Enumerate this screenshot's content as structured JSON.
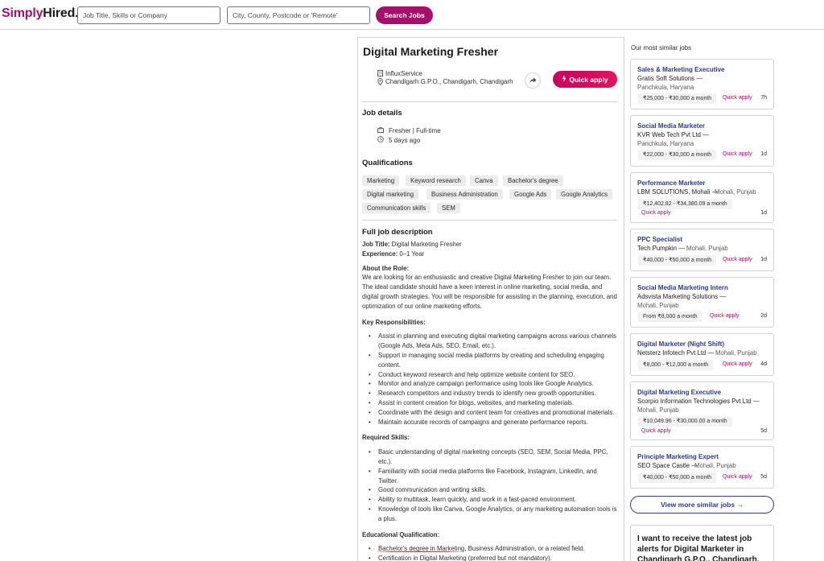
{
  "header": {
    "logo_simply": "Simply",
    "logo_hired": "Hired.",
    "what_placeholder": "Job Title, Skills or Company",
    "where_placeholder": "City, County, Postcode or 'Remote'",
    "search_label": "Search Jobs",
    "brand_color": "#a80f6b"
  },
  "job": {
    "title": "Digital Marketing Fresher",
    "company": "InfluxService",
    "location": "Chandigarh G.P.O., Chandigarh, Chandigarh",
    "quick_apply": "Quick apply",
    "details_heading": "Job details",
    "job_type": "Fresher | Full-time",
    "posted": "5 days ago",
    "qualifications_heading": "Qualifications",
    "qualifications": [
      "Marketing",
      "Keyword research",
      "Canva",
      "Bachelor's degree",
      "Digital marketing",
      "Business Administration",
      "Google Ads",
      "Google Analytics",
      "Communication skills",
      "SEM"
    ],
    "full_desc_heading": "Full job description",
    "job_title_label": "Job Title:",
    "job_title_value": " Digital Marketing Fresher",
    "experience_label": "Experience:",
    "experience_value": " 0–1 Year",
    "about_heading": "About the Role:",
    "about_text": "We are looking for an enthusiastic and creative Digital Marketing Fresher to join our team. The ideal candidate should have a keen interest in online marketing, social media, and digital growth strategies. You will be responsible for assisting in the planning, execution, and optimization of our online marketing efforts.",
    "responsibilities_heading": "Key Responsibilities:",
    "responsibilities": [
      "Assist in planning and executing digital marketing campaigns across various channels (Google Ads, Meta Ads, SEO, Email, etc.).",
      "Support in managing social media platforms by creating and scheduling engaging content.",
      "Conduct keyword research and help optimize website content for SEO.",
      "Monitor and analyze campaign performance using tools like Google Analytics.",
      "Research competitors and industry trends to identify new growth opportunities.",
      "Assist in content creation for blogs, websites, and marketing materials.",
      "Coordinate with the design and content team for creatives and promotional materials.",
      "Maintain accurate records of campaigns and generate performance reports."
    ],
    "skills_heading": "Required Skills:",
    "skills": [
      "Basic understanding of digital marketing concepts (SEO, SEM, Social Media, PPC, etc.).",
      "Familiarity with social media platforms like Facebook, Instagram, LinkedIn, and Twitter.",
      "Good communication and writing skills.",
      "Ability to multitask, learn quickly, and work in a fast-paced environment.",
      "Knowledge of tools like Canva, Google Analytics, or any marketing automation tools is a plus."
    ],
    "education_heading": "Educational Qualification:",
    "education": [
      "Bachelor's degree in Marketing, Business Administration, or a related field.",
      "Certification in Digital Marketing (preferred but not mandatory)."
    ]
  },
  "sidebar": {
    "heading": "Our most similar jobs",
    "quick_apply": "Quick apply",
    "cards": [
      {
        "title": "Sales & Marketing Executive",
        "company": "Gratis Soft Solutions —",
        "location": "Panchkula, Haryana",
        "salary": "₹25,000 - ₹30,000 a month",
        "age": "7h"
      },
      {
        "title": "Social Media Marketer",
        "company": "KVR Web Tech Pvt Ltd —",
        "location": "Panchkula, Haryana",
        "salary": "₹22,000 - ₹30,000 a month",
        "age": "1d"
      },
      {
        "title": "Performance Marketer",
        "company": "LBM SOLUTIONS, Mohali —",
        "location": "Mohali, Punjab",
        "salary": "₹12,402.82 - ₹34,380.09 a month",
        "age": "1d"
      },
      {
        "title": "PPC Specialist",
        "company": "Tech Pumpkin —",
        "location": "Mohali, Punjab",
        "salary": "₹40,000 - ₹50,000 a month",
        "age": "1d"
      },
      {
        "title": "Social Media Marketing Intern",
        "company": "Adsvista Marketing Solutions —",
        "location": "Mohali, Punjab",
        "salary": "From ₹8,000 a month",
        "age": "2d"
      },
      {
        "title": "Digital Marketer (Night Shift)",
        "company": "Netsterz Infotech Pvt Ltd —",
        "location": "Mohali, Punjab",
        "salary": "₹8,000 - ₹12,000 a month",
        "age": "4d"
      },
      {
        "title": "Digital Marketing Executive",
        "company": "Scorpio Information Technologies Pvt Ltd —",
        "location": "Mohali, Punjab",
        "salary": "₹10,049.96 - ₹30,000.00 a month",
        "age": "5d"
      },
      {
        "title": "Principle Marketing Expert",
        "company": "SEO Space Castle —",
        "location": "Mohali, Punjab",
        "salary": "₹40,000 - ₹50,000 a month",
        "age": "5d"
      }
    ],
    "more_label": "View more similar jobs →",
    "alert_text": "I want to receive the latest job alerts for Digital Marketer in Chandigarh G.P.O., Chandigarh, Chandigarh"
  }
}
